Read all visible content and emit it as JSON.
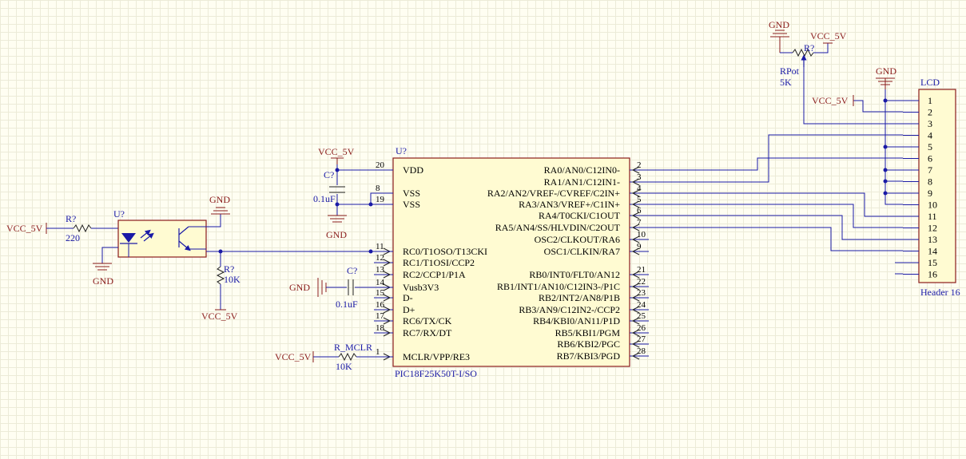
{
  "mcu": {
    "designator": "U?",
    "part": "PIC18F25K50T-I/SO",
    "left_pins": [
      {
        "num": "20",
        "name": "VDD"
      },
      {
        "num": "8",
        "name": "VSS"
      },
      {
        "num": "19",
        "name": "VSS"
      },
      {
        "num": "11",
        "name": "RC0/T1OSO/T13CKI"
      },
      {
        "num": "12",
        "name": "RC1/T1OSI/CCP2"
      },
      {
        "num": "13",
        "name": "RC2/CCP1/P1A"
      },
      {
        "num": "14",
        "name": "Vusb3V3"
      },
      {
        "num": "15",
        "name": "D-"
      },
      {
        "num": "16",
        "name": "D+"
      },
      {
        "num": "17",
        "name": "RC6/TX/CK"
      },
      {
        "num": "18",
        "name": "RC7/RX/DT"
      },
      {
        "num": "1",
        "name": "MCLR/VPP/RE3"
      }
    ],
    "right_pins": [
      {
        "num": "2",
        "name": "RA0/AN0/C12IN0-"
      },
      {
        "num": "3",
        "name": "RA1/AN1/C12IN1-"
      },
      {
        "num": "4",
        "name": "RA2/AN2/VREF-/CVREF/C2IN+"
      },
      {
        "num": "5",
        "name": "RA3/AN3/VREF+/C1IN+"
      },
      {
        "num": "6",
        "name": "RA4/T0CKI/C1OUT"
      },
      {
        "num": "7",
        "name": "RA5/AN4/SS/HLVDIN/C2OUT"
      },
      {
        "num": "10",
        "name": "OSC2/CLKOUT/RA6"
      },
      {
        "num": "9",
        "name": "OSC1/CLKIN/RA7"
      },
      {
        "num": "21",
        "name": "RB0/INT0/FLT0/AN12"
      },
      {
        "num": "22",
        "name": "RB1/INT1/AN10/C12IN3-/P1C"
      },
      {
        "num": "23",
        "name": "RB2/INT2/AN8/P1B"
      },
      {
        "num": "24",
        "name": "RB3/AN9/C12IN2-/CCP2"
      },
      {
        "num": "25",
        "name": "RB4/KBI0/AN11/P1D"
      },
      {
        "num": "26",
        "name": "RB5/KBI1/PGM"
      },
      {
        "num": "27",
        "name": "RB6/KBI2/PGC"
      },
      {
        "num": "28",
        "name": "RB7/KBI3/PGD"
      }
    ]
  },
  "lcd": {
    "designator": "LCD",
    "part": "Header 16",
    "pins": [
      "1",
      "2",
      "3",
      "4",
      "5",
      "6",
      "7",
      "8",
      "9",
      "10",
      "11",
      "12",
      "13",
      "14",
      "15",
      "16"
    ]
  },
  "pot": {
    "designator": "R?",
    "name": "RPot",
    "value": "5K",
    "gnd": "GND",
    "vcc": "VCC_5V"
  },
  "lcd_power": {
    "gnd": "GND",
    "vcc": "VCC_5V"
  },
  "decap": {
    "designator": "C?",
    "value": "0.1uF",
    "vcc": "VCC_5V",
    "gnd": "GND"
  },
  "usb_cap": {
    "designator": "C?",
    "value": "0.1uF",
    "gnd": "GND"
  },
  "opto": {
    "designator": "U?",
    "gnd": "GND"
  },
  "r_in": {
    "designator": "R?",
    "value": "220",
    "vcc": "VCC_5V",
    "gnd": "GND"
  },
  "r_pull": {
    "designator": "R?",
    "value": "10K",
    "vcc": "VCC_5V"
  },
  "r_mclr": {
    "designator": "R_MCLR",
    "value": "10K",
    "vcc": "VCC_5V"
  }
}
